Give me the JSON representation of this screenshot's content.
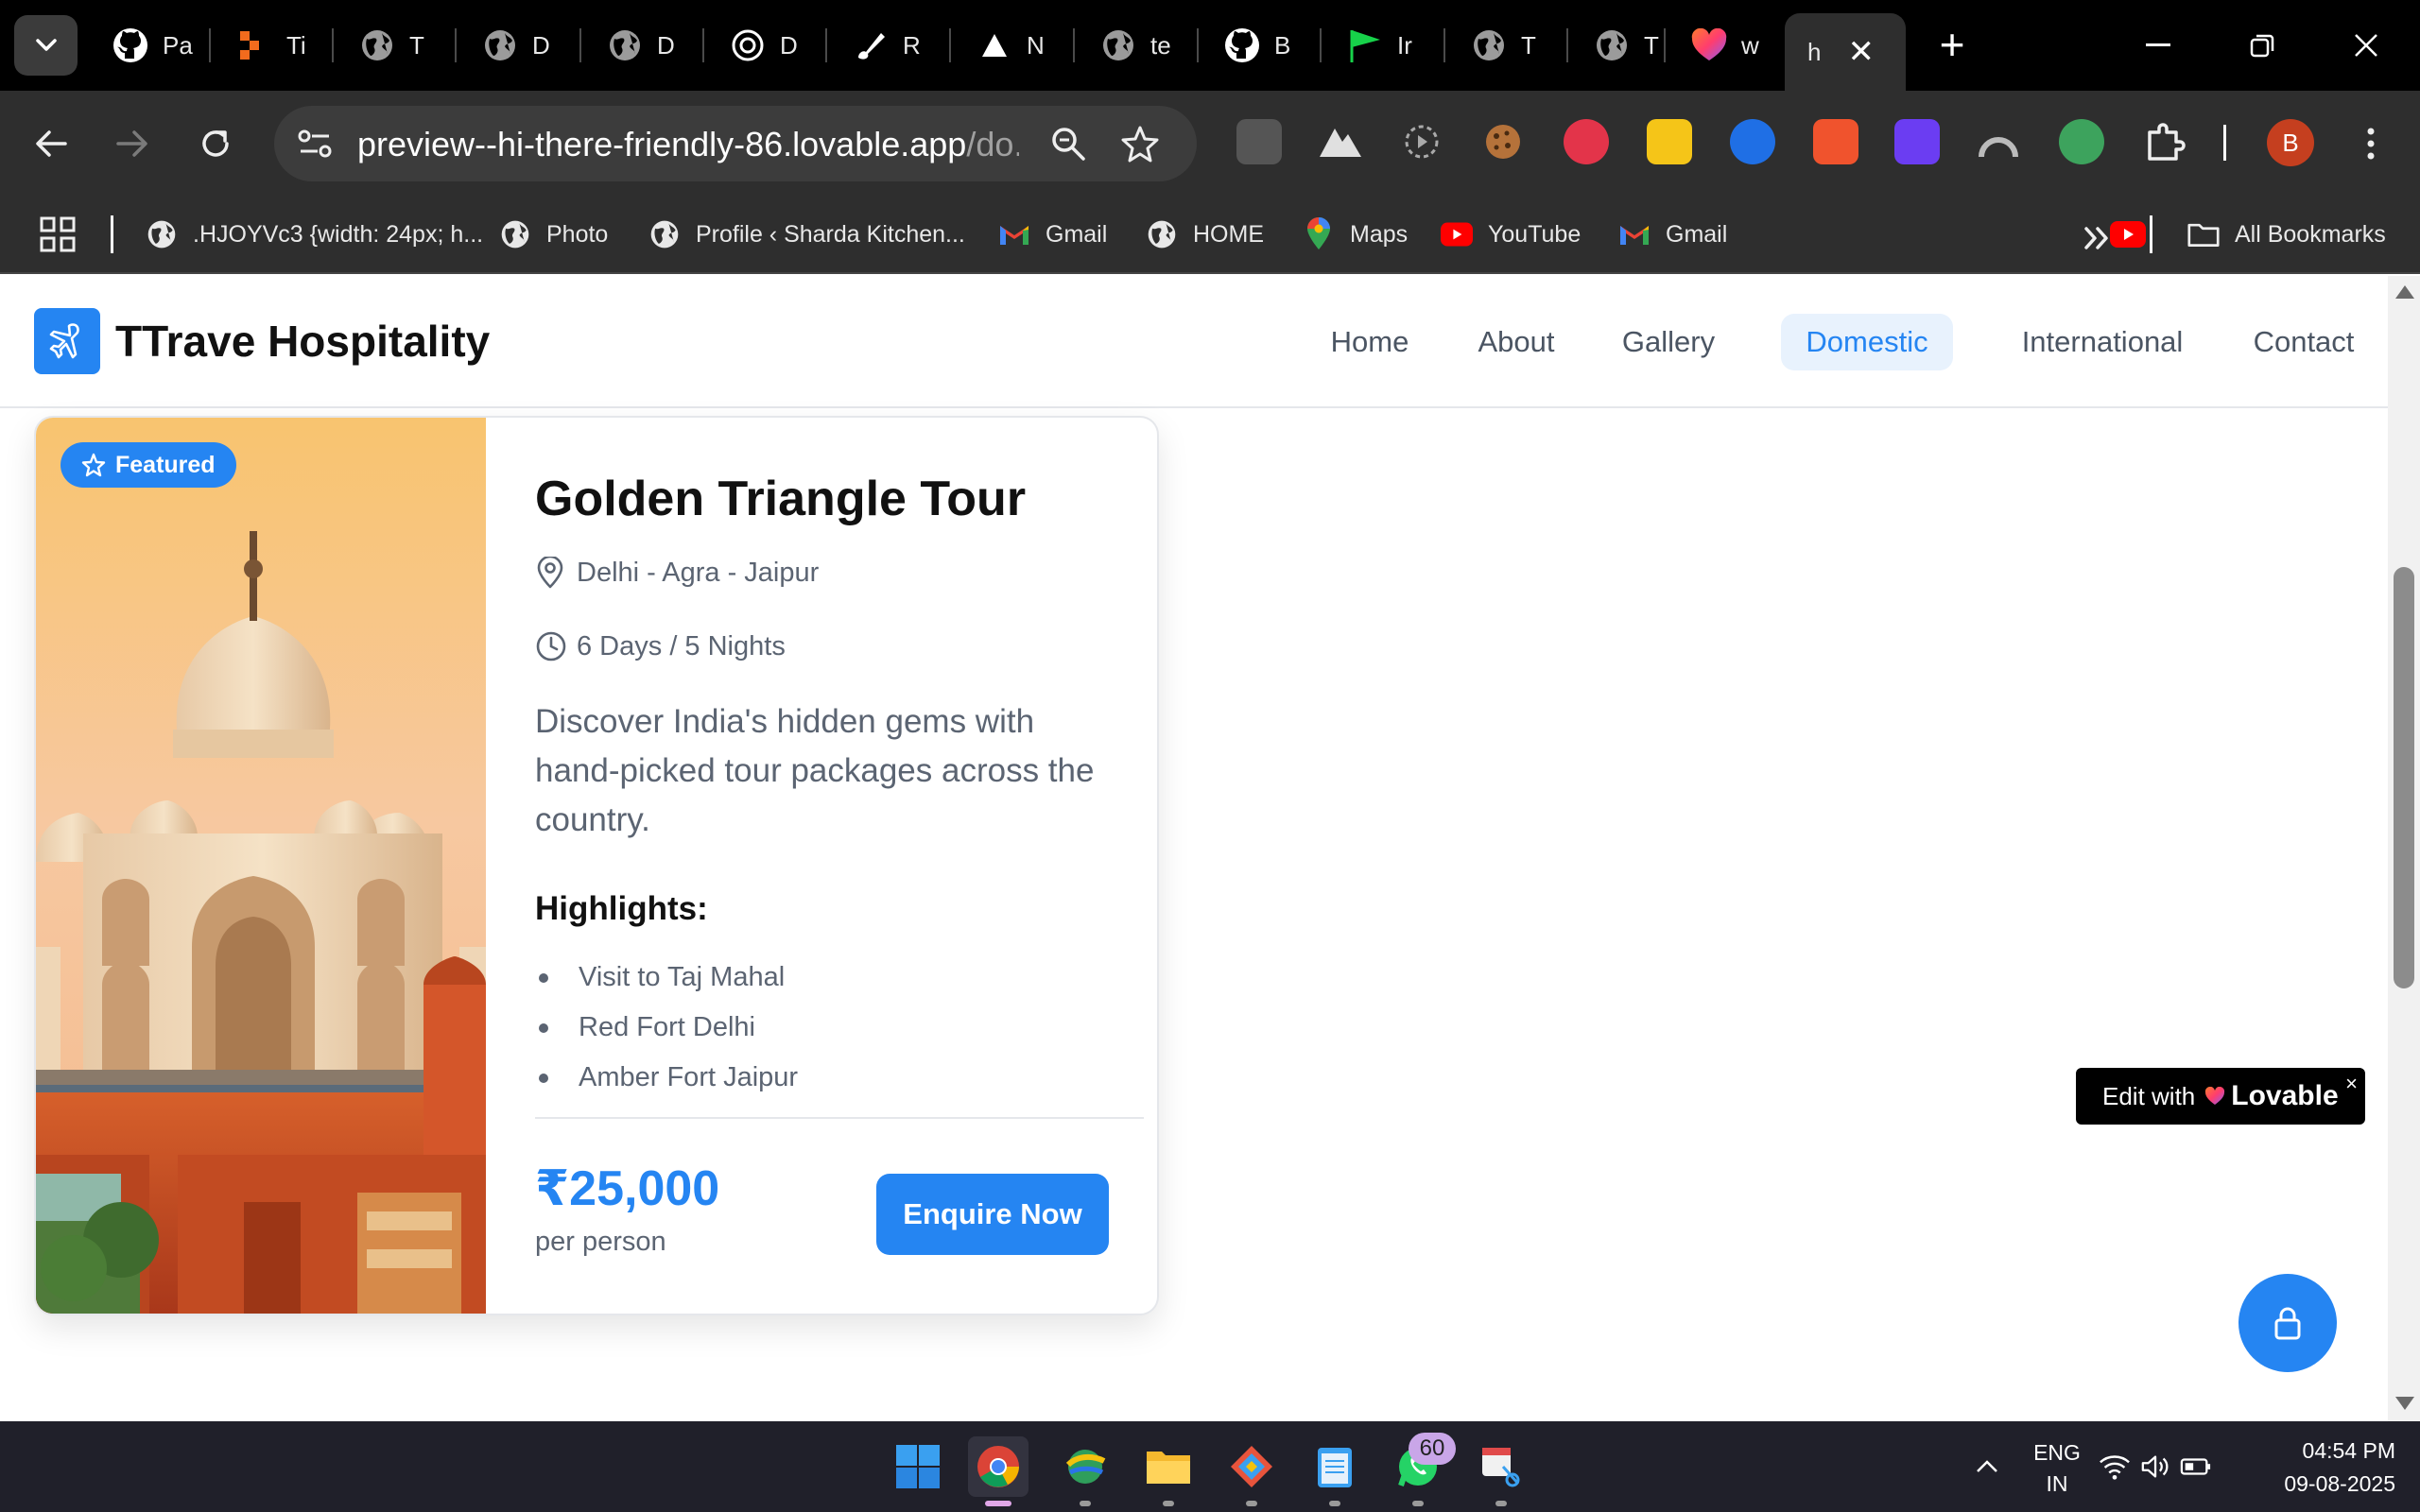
{
  "browser": {
    "tabs": [
      {
        "title": "Pa",
        "icon": "github-icon"
      },
      {
        "title": "Ti",
        "icon": "orange-app-icon"
      },
      {
        "title": "T",
        "icon": "globe-icon"
      },
      {
        "title": "D",
        "icon": "globe-icon"
      },
      {
        "title": "D",
        "icon": "globe-icon"
      },
      {
        "title": "D",
        "icon": "openai-icon"
      },
      {
        "title": "R",
        "icon": "brush-icon"
      },
      {
        "title": "N",
        "icon": "triangle-icon"
      },
      {
        "title": "te",
        "icon": "globe-icon"
      },
      {
        "title": "B",
        "icon": "github-icon"
      },
      {
        "title": "Ir",
        "icon": "green-flag-icon"
      },
      {
        "title": "T",
        "icon": "globe-icon"
      },
      {
        "title": "T",
        "icon": "globe-icon"
      },
      {
        "title": "w",
        "icon": "lovable-icon"
      }
    ],
    "active_tab": {
      "title": "h",
      "close": "✕"
    },
    "new_tab": "+",
    "url_host": "preview--hi-there-friendly-86.lovable.app",
    "url_path": "/do...",
    "profile_initial": "B",
    "bookmarks": [
      {
        "label": ".HJOYVc3 {width: 24px; h...",
        "icon": "globe-icon"
      },
      {
        "label": "Photo",
        "icon": "globe-icon"
      },
      {
        "label": "Profile ‹ Sharda Kitchen...",
        "icon": "globe-icon"
      },
      {
        "label": "Gmail",
        "icon": "gmail-icon"
      },
      {
        "label": "HOME",
        "icon": "globe-icon"
      },
      {
        "label": "Maps",
        "icon": "maps-icon"
      },
      {
        "label": "YouTube",
        "icon": "youtube-icon"
      },
      {
        "label": "Gmail",
        "icon": "gmail-icon"
      }
    ],
    "all_bookmarks": "All Bookmarks"
  },
  "site": {
    "brand": "TTrave Hospitality",
    "nav": [
      {
        "label": "Home",
        "active": false
      },
      {
        "label": "About",
        "active": false
      },
      {
        "label": "Gallery",
        "active": false
      },
      {
        "label": "Domestic",
        "active": true
      },
      {
        "label": "International",
        "active": false
      },
      {
        "label": "Contact",
        "active": false
      }
    ],
    "accent": "#2585f2"
  },
  "tour": {
    "badge": "Featured",
    "title": "Golden Triangle Tour",
    "location": "Delhi - Agra - Jaipur",
    "duration": "6 Days / 5 Nights",
    "description": "Discover India's hidden gems with hand-picked tour packages across the country.",
    "highlights_title": "Highlights:",
    "highlights": [
      "Visit to Taj Mahal",
      "Red Fort Delhi",
      "Amber Fort Jaipur"
    ],
    "price": "₹25,000",
    "price_unit": "per person",
    "cta": "Enquire Now"
  },
  "lovable_badge": {
    "prefix": "Edit with",
    "brand": "Lovable",
    "close": "×"
  },
  "taskbar": {
    "whatsapp_badge": "60",
    "lang_line1": "ENG",
    "lang_line2": "IN",
    "time": "04:54 PM",
    "date": "09-08-2025"
  }
}
